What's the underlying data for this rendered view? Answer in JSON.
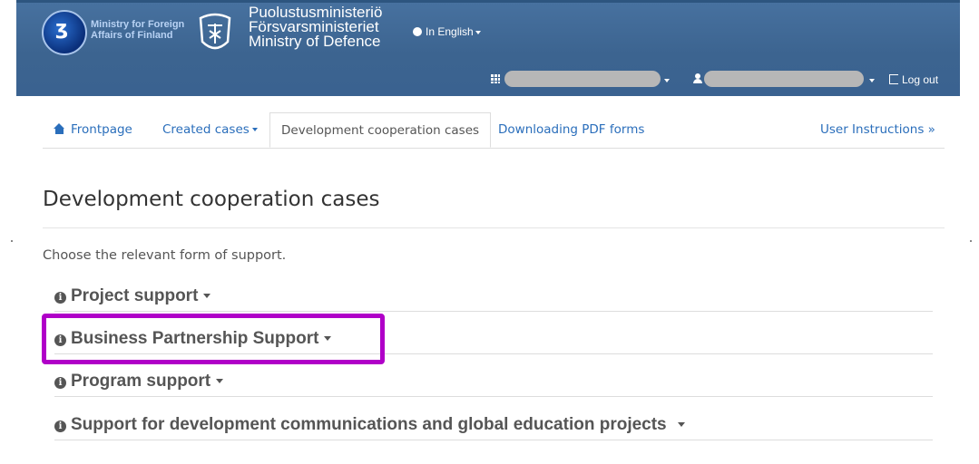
{
  "header": {
    "mfa_logo_text_line1": "Ministry for Foreign",
    "mfa_logo_text_line2": "Affairs of Finland",
    "mod_name_fi": "Puolustusministeriö",
    "mod_name_sv": "Försvarsministeriet",
    "mod_name_en": "Ministry of Defence",
    "language": "In English",
    "logout": "Log out",
    "icons": [
      "globe-icon",
      "grid-icon",
      "user-icon",
      "logout-icon"
    ]
  },
  "tabs": [
    {
      "label": "Frontpage",
      "icon": "home-icon"
    },
    {
      "label": "Created cases"
    },
    {
      "label": "Development cooperation cases",
      "active": true
    },
    {
      "label": "Downloading PDF forms"
    },
    {
      "label": "User Instructions »"
    }
  ],
  "main": {
    "title": "Development cooperation cases",
    "intro": "Choose the relevant form of support.",
    "support_types": [
      "Project support",
      "Business Partnership Support",
      "Program support",
      "Support for development communications and global education projects"
    ],
    "highlighted": "Business Partnership Support"
  },
  "colors": {
    "header_blue": "#3c6490",
    "link_blue": "#2a6ebb",
    "highlight": "#b000c8",
    "redaction": "#b7b7b7"
  }
}
